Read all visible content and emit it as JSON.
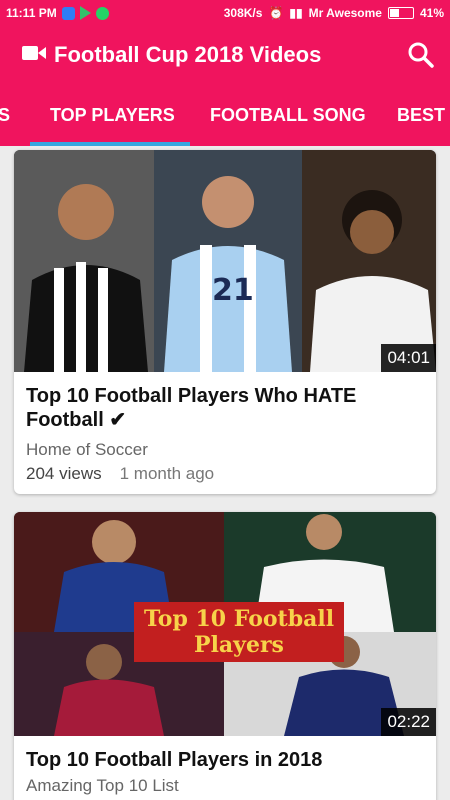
{
  "status_bar": {
    "time": "11:11 PM",
    "network_speed": "308K/s",
    "carrier": "Mr Awesome",
    "battery": "41%",
    "battery_level": 0.41
  },
  "app_bar": {
    "title": "Football Cup 2018 Videos",
    "camera_icon": "video-camera-icon",
    "search_icon": "search-icon"
  },
  "tabs": [
    {
      "label": "S"
    },
    {
      "label": "TOP PLAYERS"
    },
    {
      "label": "FOOTBALL SONG"
    },
    {
      "label": "BEST I"
    }
  ],
  "colors": {
    "primary": "#f0145e",
    "indicator": "#37a6df"
  },
  "videos": [
    {
      "title": "Top 10 Football Players Who HATE Football ✔",
      "channel": "Home of Soccer",
      "views": "204 views",
      "age": "1 month ago",
      "duration": "04:01"
    },
    {
      "title": "Top 10 Football Players in 2018",
      "channel": "Amazing Top 10 List",
      "duration": "02:22",
      "overlay": "Top 10 Football Players"
    }
  ]
}
